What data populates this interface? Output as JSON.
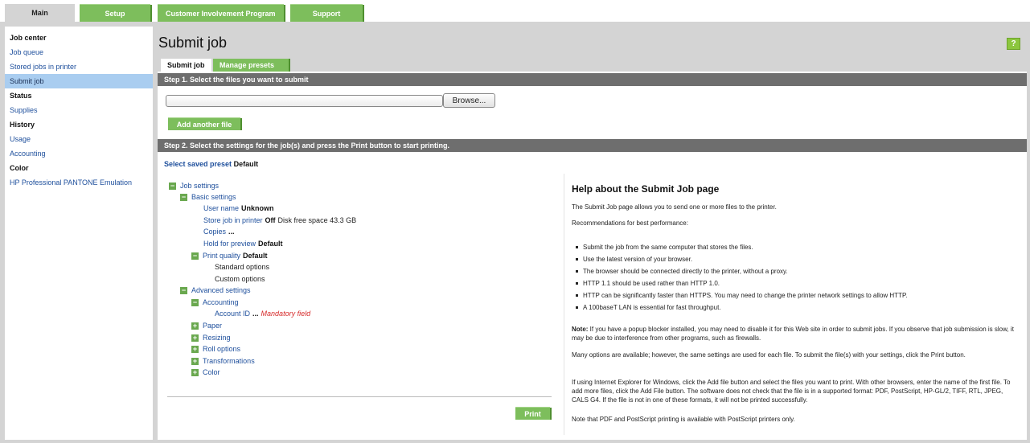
{
  "top_tabs": [
    "Main",
    "Setup",
    "Customer Involvement Program",
    "Support"
  ],
  "sidebar": {
    "items": [
      {
        "label": "Job center",
        "type": "header"
      },
      {
        "label": "Job queue",
        "type": "link"
      },
      {
        "label": "Stored jobs in printer",
        "type": "link"
      },
      {
        "label": "Submit job",
        "type": "selected"
      },
      {
        "label": "Status",
        "type": "header"
      },
      {
        "label": "Supplies",
        "type": "link"
      },
      {
        "label": "History",
        "type": "header"
      },
      {
        "label": "Usage",
        "type": "link"
      },
      {
        "label": "Accounting",
        "type": "link"
      },
      {
        "label": "Color",
        "type": "header"
      },
      {
        "label": "HP Professional PANTONE Emulation",
        "type": "link"
      }
    ]
  },
  "page": {
    "title": "Submit job",
    "help_button": "?",
    "subtabs": [
      "Submit job",
      "Manage presets"
    ]
  },
  "step1": {
    "label": "Step 1. Select the files you want to submit",
    "file_value": "",
    "browse_label": "Browse...",
    "add_file_label": "Add another file"
  },
  "step2": {
    "label": "Step 2. Select the settings for the job(s) and press the Print button to start printing.",
    "preset_label": "Select saved preset",
    "preset_value": "Default"
  },
  "tree": {
    "job_settings": "Job settings",
    "basic_settings": "Basic settings",
    "user_name": {
      "label": "User name",
      "value": "Unknown"
    },
    "store_job": {
      "label": "Store job in printer",
      "value": "Off",
      "extra": "Disk free space 43.3 GB"
    },
    "copies": {
      "label": "Copies",
      "value": "..."
    },
    "hold_preview": {
      "label": "Hold for preview",
      "value": "Default"
    },
    "print_quality": {
      "label": "Print quality",
      "value": "Default"
    },
    "standard_options": "Standard options",
    "custom_options": "Custom options",
    "advanced_settings": "Advanced settings",
    "accounting": "Accounting",
    "account_id": {
      "label": "Account ID",
      "value": "...",
      "note": "Mandatory field"
    },
    "paper": "Paper",
    "resizing": "Resizing",
    "roll_options": "Roll options",
    "transformations": "Transformations",
    "color": "Color",
    "toggle_minus": "−",
    "toggle_plus": "+"
  },
  "print_label": "Print",
  "help": {
    "title": "Help about the Submit Job page",
    "intro": "The Submit Job page allows you to send one or more files to the printer.",
    "recommendations": "Recommendations for best performance:",
    "bullets": [
      "Submit the job from the same computer that stores the files.",
      "Use the latest version of your browser.",
      "The browser should be connected directly to the printer, without a proxy.",
      "HTTP 1.1 should be used rather than HTTP 1.0.",
      "HTTP can be significantly faster than HTTPS. You may need to change the printer network settings to allow HTTP.",
      "A 100baseT LAN is essential for fast throughput."
    ],
    "note_label": "Note:",
    "note_text": " If you have a popup blocker installed, you may need to disable it for this Web site in order to submit jobs. If you observe that job submission is slow, it may be due to interference from other programs, such as firewalls.",
    "para2": "Many options are available; however, the same settings are used for each file. To submit the file(s) with your settings, click the Print button.",
    "para3": "If using Internet Explorer for Windows, click the Add file button and select the files you want to print. With other browsers, enter the name of the first file. To add more files, click the Add File button. The software does not check that the file is in a supported format: PDF, PostScript, HP-GL/2, TIFF, RTL, JPEG, CALS G4. If the file is not in one of these formats, it will not be printed successfully.",
    "para4": "Note that PDF and PostScript printing is available with PostScript printers only."
  },
  "colors": {
    "accent_green": "#7dbe5c",
    "link_blue": "#1e4f9c",
    "selected_bg": "#a9cdf0",
    "step_bar": "#6e6e6e",
    "mandatory_red": "#d62b2b"
  }
}
